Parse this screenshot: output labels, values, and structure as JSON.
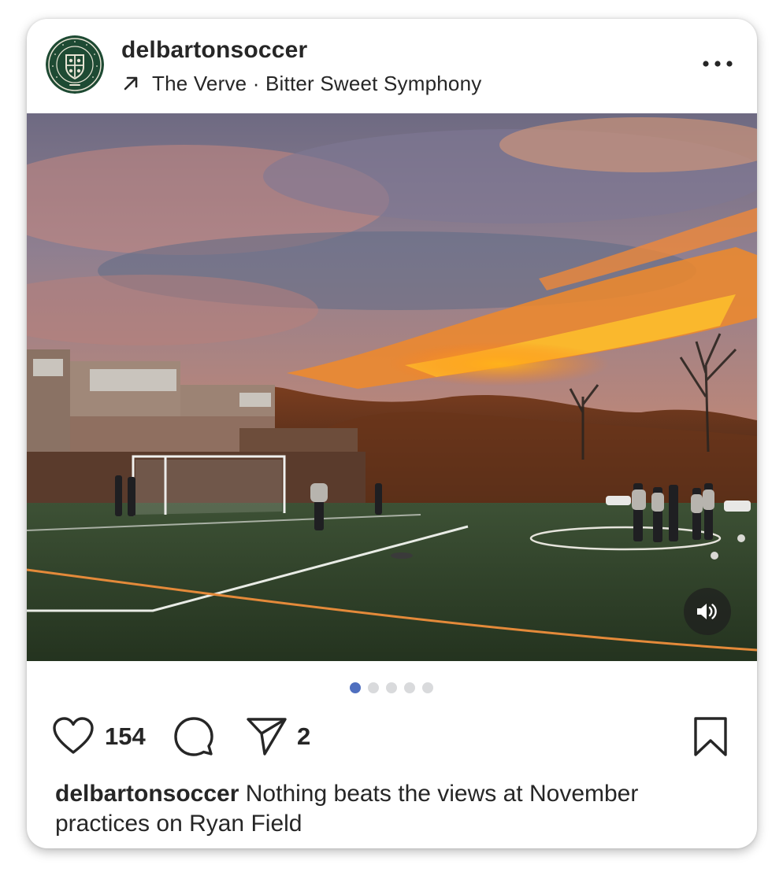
{
  "post": {
    "username": "delbartonsoccer",
    "audio": {
      "icon": "arrow-up-right-icon",
      "track": "The Verve · Bitter Sweet Symphony"
    },
    "more_icon": "more-horizontal-icon",
    "carousel": {
      "total": 5,
      "active_index": 0
    },
    "likes": "154",
    "shares": "2",
    "caption_user": "delbartonsoccer",
    "caption_text": "Nothing beats the views at November practices on Ryan Field"
  },
  "icons": {
    "like": "heart-icon",
    "comment": "comment-icon",
    "share": "send-icon",
    "save": "bookmark-icon",
    "sound": "speaker-icon"
  },
  "colors": {
    "text": "#262626",
    "dot_active": "#4f6fbf",
    "dot_inactive": "#d9dadc",
    "avatar_green": "#1e4a33"
  }
}
